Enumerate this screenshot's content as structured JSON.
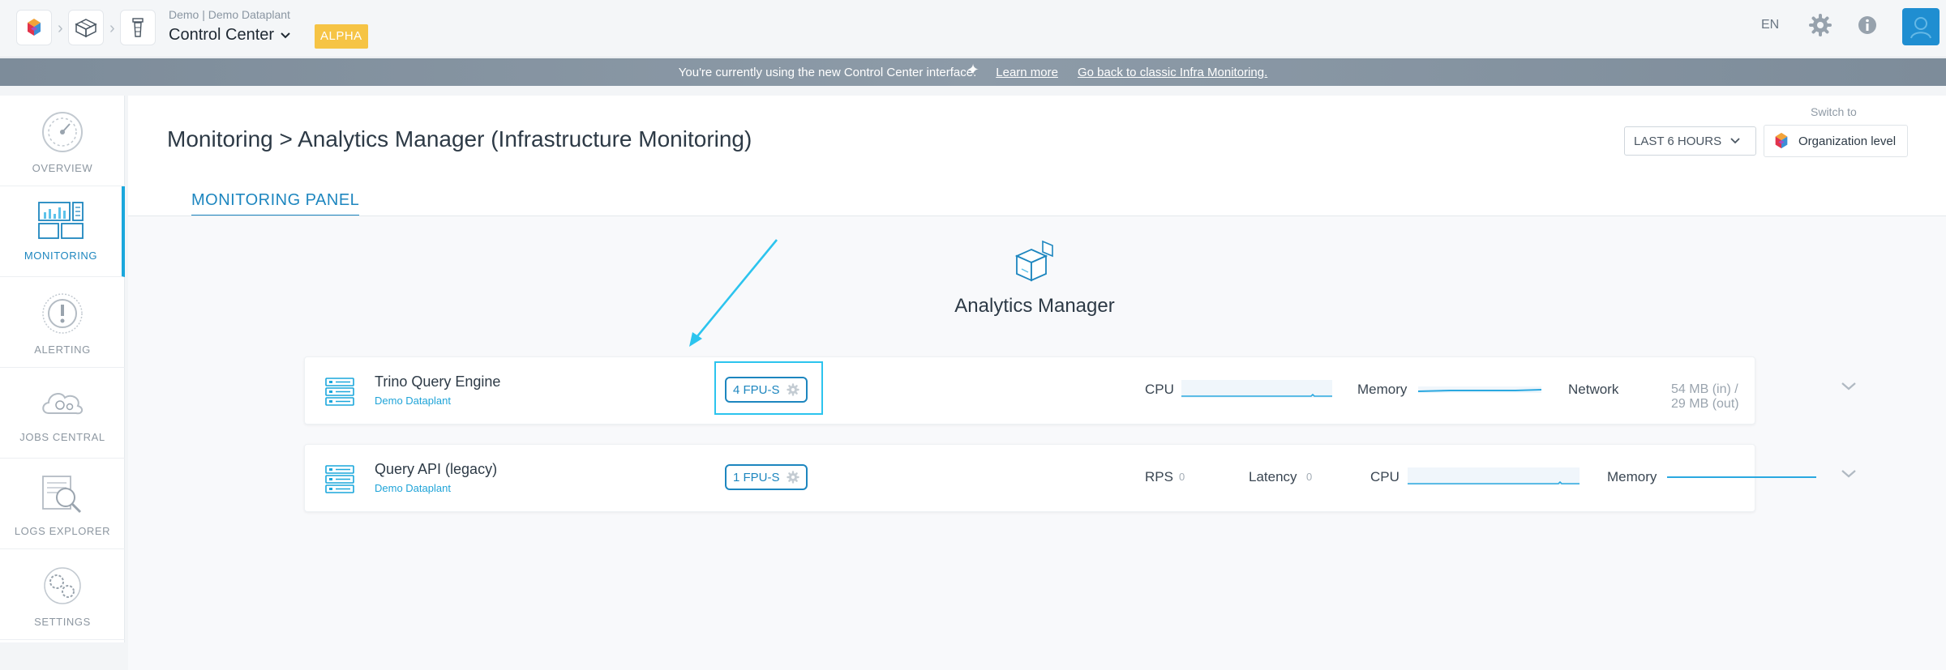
{
  "header": {
    "org_line": "Demo | Demo Dataplant",
    "title": "Control Center",
    "badge": "ALPHA",
    "language": "EN",
    "icons": [
      "app-logo-icon",
      "dataplant-cube-icon",
      "lighthouse-icon",
      "gear-icon",
      "info-icon",
      "avatar-icon"
    ],
    "colors": {
      "badge": "#f6c445",
      "avatar": "#1f8ed1"
    }
  },
  "banner": {
    "message": "You're currently using the new Control Center interface.",
    "learn_more": "Learn more",
    "go_back": "Go back to classic Infra Monitoring."
  },
  "sidebar": {
    "items": [
      {
        "label": "OVERVIEW",
        "icon": "gauge-icon",
        "active": false
      },
      {
        "label": "MONITORING",
        "icon": "monitoring-panel-icon",
        "active": true
      },
      {
        "label": "ALERTING",
        "icon": "alert-icon",
        "active": false
      },
      {
        "label": "JOBS CENTRAL",
        "icon": "jobs-cloud-icon",
        "active": false
      },
      {
        "label": "LOGS EXPLORER",
        "icon": "logs-magnifier-icon",
        "active": false
      },
      {
        "label": "SETTINGS",
        "icon": "settings-gear-icon",
        "active": false
      }
    ]
  },
  "main": {
    "breadcrumb_root": "Monitoring",
    "breadcrumb_sep": ">",
    "breadcrumb_leaf": "Analytics Manager (Infrastructure Monitoring)",
    "switch_to": "Switch to",
    "time_range": "LAST 6 HOURS",
    "org_level": "Organization level",
    "tab": "MONITORING PANEL",
    "section_title": "Analytics Manager",
    "accent": "#1d86bf",
    "highlight": "#2cc4ee"
  },
  "services": [
    {
      "name": "Trino Query Engine",
      "sub": "Demo Dataplant",
      "fpu": "4 FPU-S",
      "metrics": {
        "cpu": "CPU",
        "memory": "Memory",
        "network": "Network",
        "network_value": "54 MB (in) / 29 MB (out)"
      }
    },
    {
      "name": "Query API (legacy)",
      "sub": "Demo Dataplant",
      "fpu": "1 FPU-S",
      "metrics": {
        "rps": "RPS",
        "rps_value": "0",
        "latency": "Latency",
        "latency_value": "0",
        "cpu": "CPU",
        "memory": "Memory"
      }
    }
  ]
}
